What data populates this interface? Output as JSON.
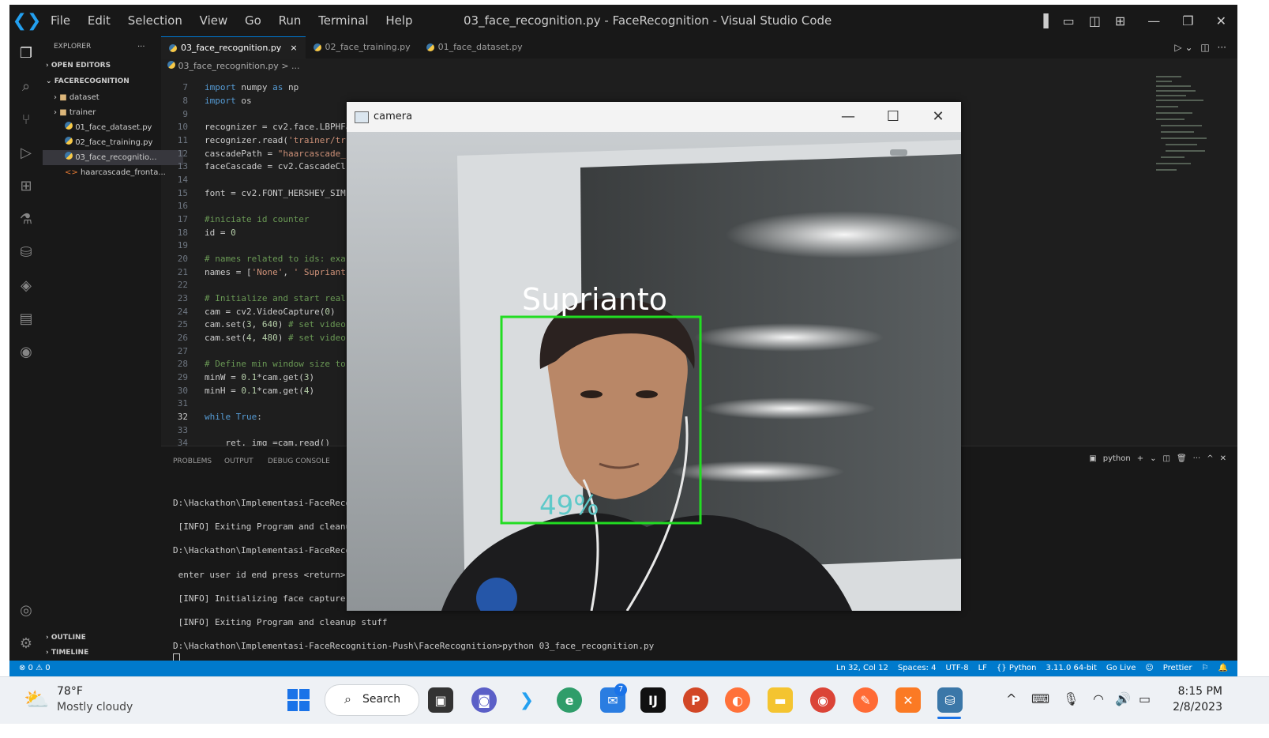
{
  "titlebar": {
    "menu": [
      "File",
      "Edit",
      "Selection",
      "View",
      "Go",
      "Run",
      "Terminal",
      "Help"
    ],
    "window_title": "03_face_recognition.py - FaceRecognition - Visual Studio Code"
  },
  "sidebar": {
    "header": "EXPLORER",
    "more": "···",
    "open_editors": "OPEN EDITORS",
    "project": "FACERECOGNITION",
    "items": [
      {
        "label": "dataset",
        "type": "folder"
      },
      {
        "label": "trainer",
        "type": "folder"
      },
      {
        "label": "01_face_dataset.py",
        "type": "py"
      },
      {
        "label": "02_face_training.py",
        "type": "py"
      },
      {
        "label": "03_face_recognitio...",
        "type": "py"
      },
      {
        "label": "haarcascade_fronta...",
        "type": "xml"
      }
    ],
    "outline": "OUTLINE",
    "timeline": "TIMELINE"
  },
  "tabs": [
    {
      "label": "03_face_recognition.py",
      "close": "×"
    },
    {
      "label": "02_face_training.py"
    },
    {
      "label": "01_face_dataset.py"
    }
  ],
  "breadcrumb": "03_face_recognition.py > ...",
  "editor": {
    "line_numbers": [
      "7",
      "8",
      "9",
      "10",
      "11",
      "12",
      "13",
      "14",
      "15",
      "16",
      "17",
      "18",
      "19",
      "20",
      "21",
      "22",
      "23",
      "24",
      "25",
      "26",
      "27",
      "28",
      "29",
      "30",
      "31",
      "32",
      "33",
      "34"
    ]
  },
  "panel": {
    "tabs": [
      "PROBLEMS",
      "OUTPUT",
      "DEBUG CONSOLE"
    ],
    "terminal_name": "python",
    "lines": [
      "D:\\Hackathon\\Implementasi-FaceReco",
      " [INFO] Exiting Program and cleanu",
      "D:\\Hackathon\\Implementasi-FaceReco",
      " enter user id end press <return>",
      " [INFO] Initializing face capture.",
      " [INFO] Exiting Program and cleanup stuff",
      "D:\\Hackathon\\Implementasi-FaceRecognition-Push\\FaceRecognition>python 03_face_recognition.py"
    ]
  },
  "statusbar": {
    "left": "⊗ 0  ⚠ 0",
    "items": [
      "Ln 32, Col 12",
      "Spaces: 4",
      "UTF-8",
      "LF",
      "{} Python",
      "3.11.0 64-bit",
      "Go Live",
      "Prettier"
    ]
  },
  "camera": {
    "title": "camera",
    "label": "Suprianto",
    "confidence": "49%",
    "box_color": "#22dd22"
  },
  "taskbar": {
    "weather_temp": "78°F",
    "weather_desc": "Mostly cloudy",
    "search_label": "Search",
    "time": "8:15 PM",
    "date": "2/8/2023",
    "notification_count": "7"
  }
}
